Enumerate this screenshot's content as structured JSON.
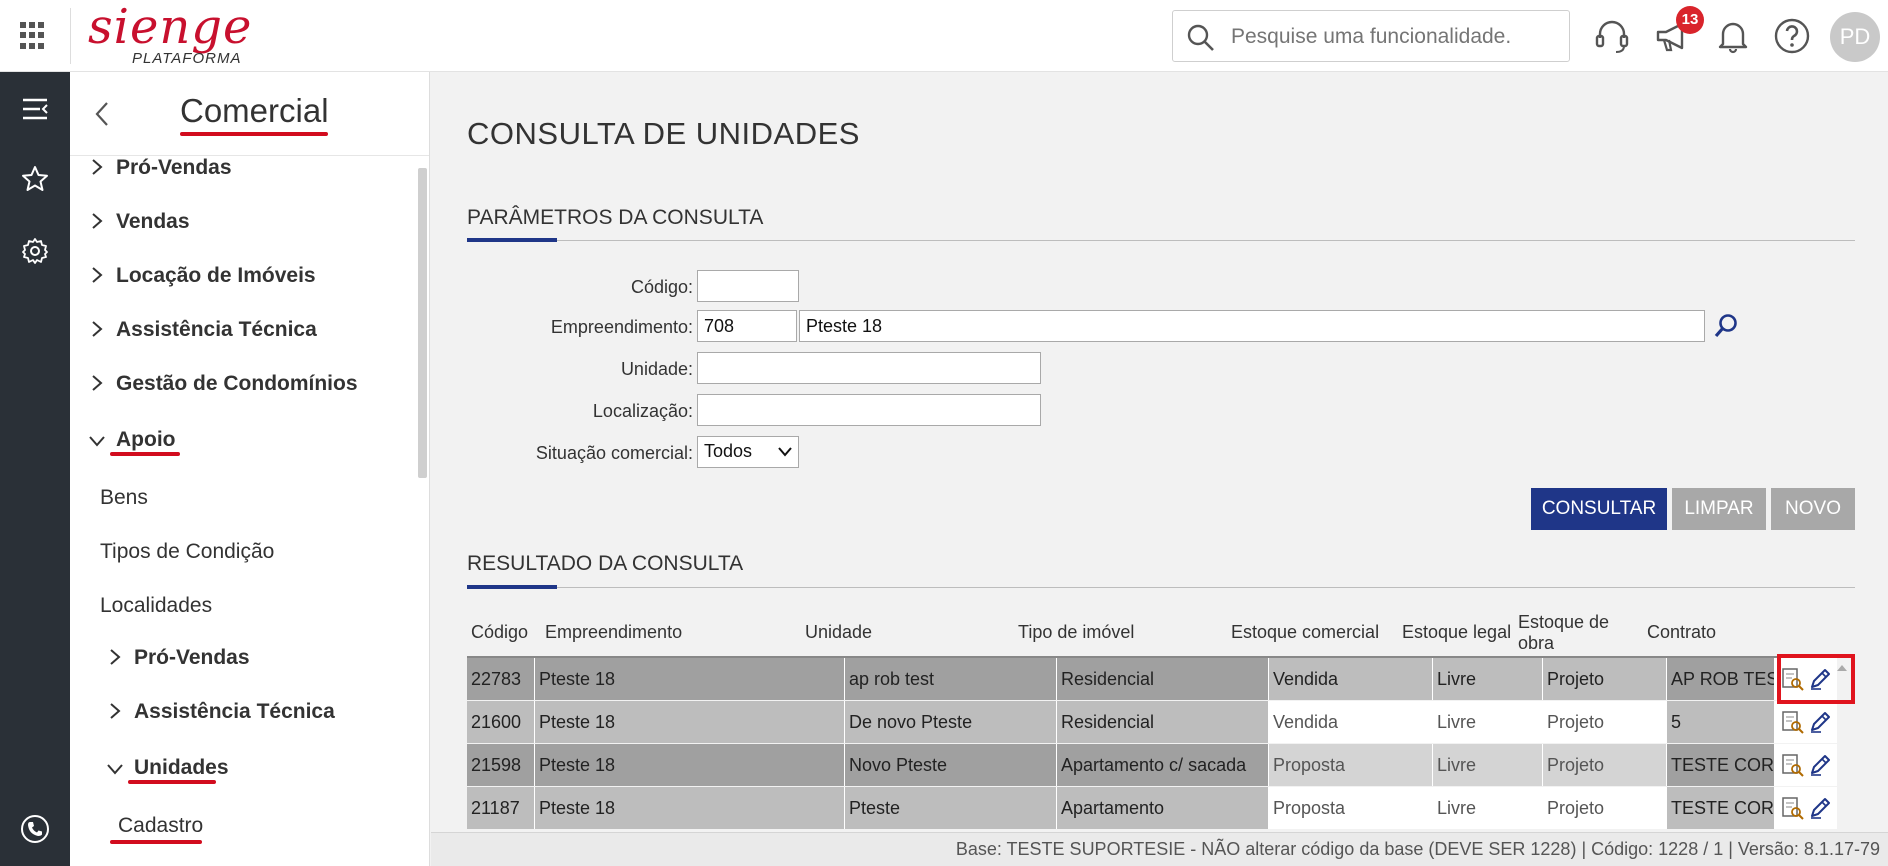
{
  "app": {
    "logo_text": "sienge",
    "logo_sub": "PLATAFORMA",
    "search_placeholder": "Pesquise uma funcionalidade.",
    "notification_count": "13",
    "user_initials": "PD",
    "brand_color": "#c8102e",
    "accent_color": "#1f3688"
  },
  "sidebar": {
    "title": "Comercial",
    "items": [
      {
        "label": "Pró-Vendas"
      },
      {
        "label": "Vendas"
      },
      {
        "label": "Locação de Imóveis"
      },
      {
        "label": "Assistência Técnica"
      },
      {
        "label": "Gestão de Condomínios"
      },
      {
        "label": "Apoio"
      },
      {
        "label": "Bens"
      },
      {
        "label": "Tipos de Condição"
      },
      {
        "label": "Localidades"
      },
      {
        "label": "Pró-Vendas"
      },
      {
        "label": "Assistência Técnica"
      },
      {
        "label": "Unidades"
      },
      {
        "label": "Cadastro"
      }
    ]
  },
  "main": {
    "page_title": "CONSULTA DE UNIDADES",
    "params_title": "PARÂMETROS DA CONSULTA",
    "fields": {
      "codigo_label": "Código:",
      "codigo_value": "",
      "empreendimento_label": "Empreendimento:",
      "empreendimento_code": "708",
      "empreendimento_name": "Pteste 18",
      "unidade_label": "Unidade:",
      "unidade_value": "",
      "localizacao_label": "Localização:",
      "localizacao_value": "",
      "situacao_label": "Situação comercial:",
      "situacao_value": "Todos"
    },
    "buttons": {
      "consultar": "CONSULTAR",
      "limpar": "LIMPAR",
      "novo": "NOVO"
    },
    "results_title": "RESULTADO DA CONSULTA",
    "columns": [
      "Código",
      "Empreendimento",
      "Unidade",
      "Tipo de imóvel",
      "Estoque comercial",
      "Estoque legal",
      "Estoque de obra",
      "Contrato"
    ],
    "rows": [
      {
        "codigo": "22783",
        "empreendimento": "Pteste 18",
        "unidade": "ap rob test",
        "tipo": "Residencial",
        "estoque_comercial": "Vendida",
        "estoque_legal": "Livre",
        "estoque_obra": "Projeto",
        "contrato": "AP ROB TEST"
      },
      {
        "codigo": "21600",
        "empreendimento": "Pteste 18",
        "unidade": "De novo Pteste",
        "tipo": "Residencial",
        "estoque_comercial": "Vendida",
        "estoque_legal": "Livre",
        "estoque_obra": "Projeto",
        "contrato": "5"
      },
      {
        "codigo": "21598",
        "empreendimento": "Pteste 18",
        "unidade": "Novo Pteste",
        "tipo": "Apartamento c/ sacada",
        "estoque_comercial": "Proposta",
        "estoque_legal": "Livre",
        "estoque_obra": "Projeto",
        "contrato": "TESTE CORR"
      },
      {
        "codigo": "21187",
        "empreendimento": "Pteste 18",
        "unidade": "Pteste",
        "tipo": "Apartamento",
        "estoque_comercial": "Proposta",
        "estoque_legal": "Livre",
        "estoque_obra": "Projeto",
        "contrato": "TESTE CORR"
      }
    ]
  },
  "footer": {
    "text": "Base: TESTE SUPORTESIE - NÃO alterar código da base (DEVE SER 1228) | Código: 1228 / 1 | Versão: 8.1.17-79"
  }
}
